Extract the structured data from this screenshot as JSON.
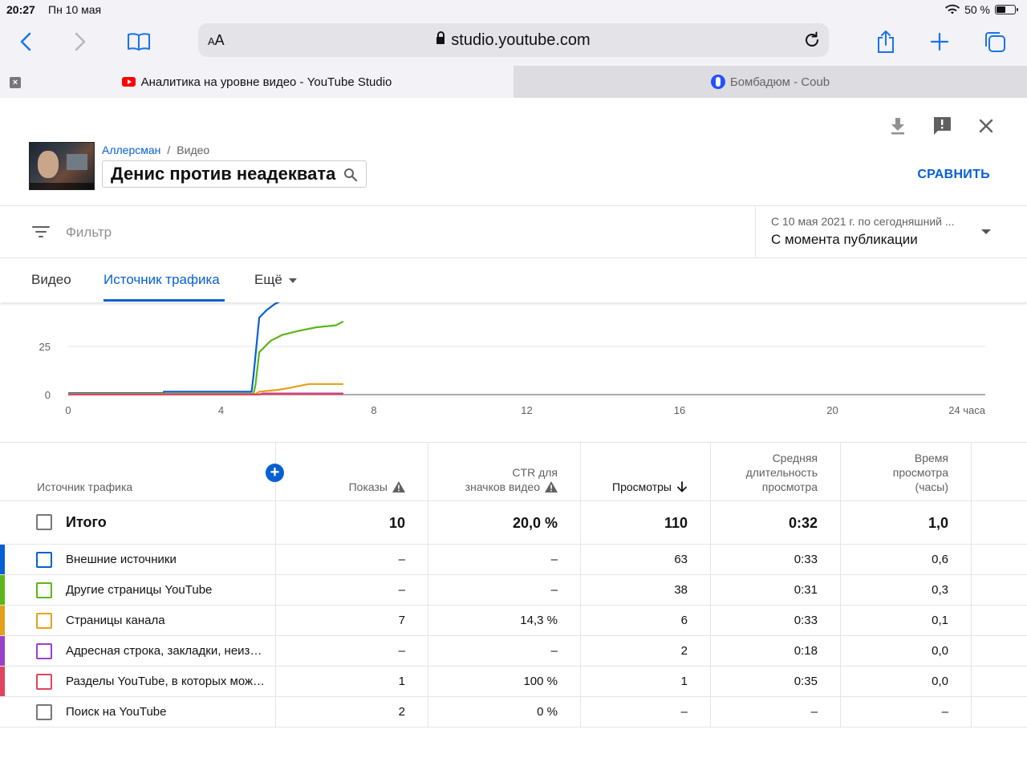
{
  "status_bar": {
    "time": "20:27",
    "date": "Пн 10 мая",
    "battery": "50 %"
  },
  "browser": {
    "aa_label": "AA",
    "url": "studio.youtube.com",
    "tabs": [
      {
        "title": "Аналитика на уровне видео - YouTube Studio",
        "active": true
      },
      {
        "title": "Бомбадюм - Coub",
        "active": false
      }
    ]
  },
  "header": {
    "breadcrumb_channel": "Аллерсман",
    "breadcrumb_sep": "/",
    "breadcrumb_page": "Видео",
    "video_title": "Денис против неадеквата",
    "compare_label": "СРАВНИТЬ"
  },
  "filter": {
    "placeholder": "Фильтр",
    "date_sub": "С 10 мая 2021 г. по сегодняшний ...",
    "date_main": "С момента публикации"
  },
  "tabs": {
    "video": "Видео",
    "traffic": "Источник трафика",
    "more": "Ещё"
  },
  "chart_data": {
    "type": "line",
    "x_ticks": [
      "0",
      "4",
      "8",
      "12",
      "16",
      "20",
      "24 часа"
    ],
    "y_ticks": [
      "0",
      "25"
    ],
    "xlim": [
      0,
      24
    ],
    "ylim": [
      0,
      50
    ],
    "grid": true,
    "series": [
      {
        "color": "#065fd4",
        "x": [
          0,
          2.5,
          2.5,
          4.8,
          4.85,
          5.0,
          5.2,
          5.4,
          5.6,
          5.7
        ],
        "y": [
          0.8,
          0.8,
          1.5,
          1.5,
          10,
          40,
          44,
          47,
          49,
          51
        ]
      },
      {
        "color": "#5bb617",
        "x": [
          0,
          4.85,
          4.9,
          5.0,
          5.3,
          5.6,
          6.0,
          6.5,
          7.0,
          7.2
        ],
        "y": [
          0.5,
          0.5,
          5,
          22,
          28,
          31,
          33,
          35,
          36,
          38
        ]
      },
      {
        "color": "#e6a019",
        "x": [
          0,
          4.9,
          5.0,
          5.5,
          5.8,
          6.3,
          7.2
        ],
        "y": [
          0.3,
          0.3,
          1.5,
          2.5,
          3.5,
          5.5,
          5.5
        ]
      },
      {
        "color": "#9b3fcf",
        "x": [
          0,
          5.0,
          5.1,
          7.2
        ],
        "y": [
          0.1,
          0.1,
          0.6,
          0.6
        ]
      },
      {
        "color": "#e0445e",
        "x": [
          0,
          5.0,
          5.1,
          7.2
        ],
        "y": [
          0.05,
          0.05,
          0.3,
          0.3
        ]
      }
    ]
  },
  "table": {
    "headers": {
      "source": "Источник трафика",
      "impressions": "Показы",
      "ctr_1": "CTR для",
      "ctr_2": "значков видео",
      "views": "Просмотры",
      "avd_1": "Средняя",
      "avd_2": "длительность",
      "avd_3": "просмотра",
      "wt_1": "Время",
      "wt_2": "просмотра",
      "wt_3": "(часы)"
    },
    "total": {
      "label": "Итого",
      "impressions": "10",
      "ctr": "20,0 %",
      "views": "110",
      "avd": "0:32",
      "watch_time": "1,0"
    },
    "rows": [
      {
        "label": "Внешние источники",
        "color": "#065fd4",
        "impressions": "–",
        "ctr": "–",
        "views": "63",
        "avd": "0:33",
        "watch_time": "0,6"
      },
      {
        "label": "Другие страницы YouTube",
        "color": "#5bb617",
        "impressions": "–",
        "ctr": "–",
        "views": "38",
        "avd": "0:31",
        "watch_time": "0,3"
      },
      {
        "label": "Страницы канала",
        "color": "#e6a019",
        "impressions": "7",
        "ctr": "14,3 %",
        "views": "6",
        "avd": "0:33",
        "watch_time": "0,1"
      },
      {
        "label": "Адресная строка, закладки, неизв…",
        "color": "#9b3fcf",
        "impressions": "–",
        "ctr": "–",
        "views": "2",
        "avd": "0:18",
        "watch_time": "0,0"
      },
      {
        "label": "Разделы YouTube, в которых мож…",
        "color": "#e0445e",
        "impressions": "1",
        "ctr": "100 %",
        "views": "1",
        "avd": "0:35",
        "watch_time": "0,0"
      },
      {
        "label": "Поиск на YouTube",
        "color": "#777777",
        "impressions": "2",
        "ctr": "0 %",
        "views": "–",
        "avd": "–",
        "watch_time": "–"
      }
    ]
  }
}
